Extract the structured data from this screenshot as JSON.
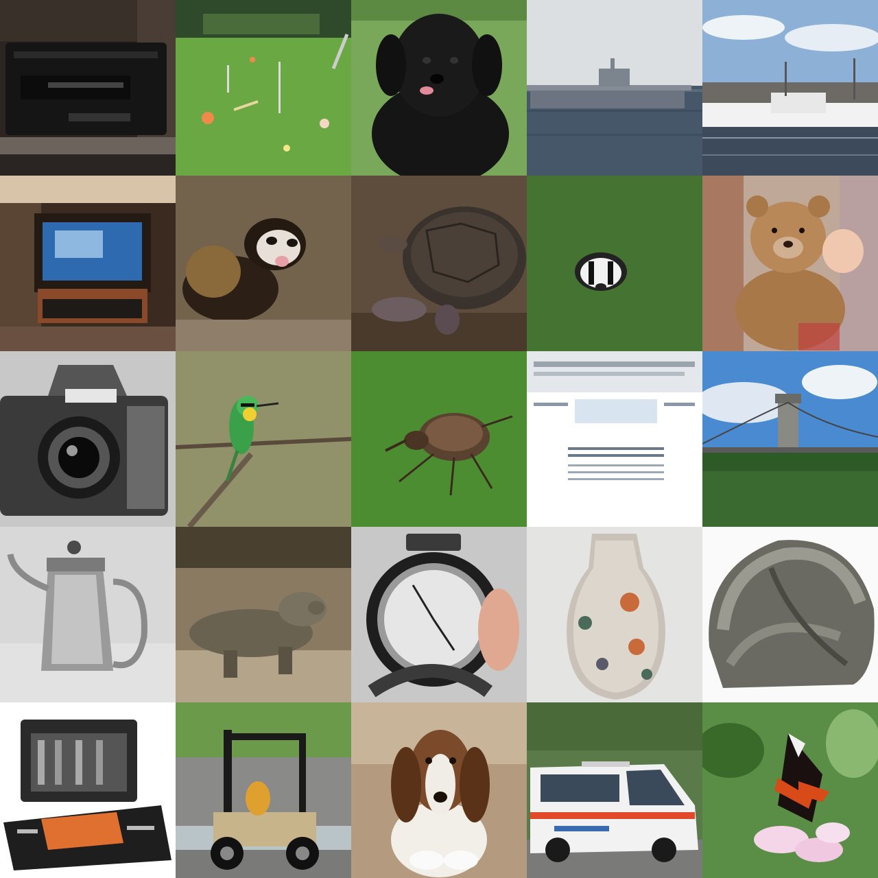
{
  "grid": {
    "rows": 5,
    "cols": 5,
    "tiles": [
      {
        "subject": "cassette-player"
      },
      {
        "subject": "croquet-lawn"
      },
      {
        "subject": "black-dog"
      },
      {
        "subject": "aircraft-carrier"
      },
      {
        "subject": "harbor-boats"
      },
      {
        "subject": "television-room"
      },
      {
        "subject": "ferret"
      },
      {
        "subject": "turtle"
      },
      {
        "subject": "badger"
      },
      {
        "subject": "teddy-bear"
      },
      {
        "subject": "camera"
      },
      {
        "subject": "bee-eater-bird"
      },
      {
        "subject": "weevil-beetle"
      },
      {
        "subject": "web-page"
      },
      {
        "subject": "suspension-bridge"
      },
      {
        "subject": "coffee-pot"
      },
      {
        "subject": "komodo-dragon"
      },
      {
        "subject": "stopwatch"
      },
      {
        "subject": "painted-vase"
      },
      {
        "subject": "knit-cap"
      },
      {
        "subject": "toolbox"
      },
      {
        "subject": "forklift"
      },
      {
        "subject": "basset-hound"
      },
      {
        "subject": "ambulance-van"
      },
      {
        "subject": "red-admiral-butterfly"
      }
    ]
  }
}
